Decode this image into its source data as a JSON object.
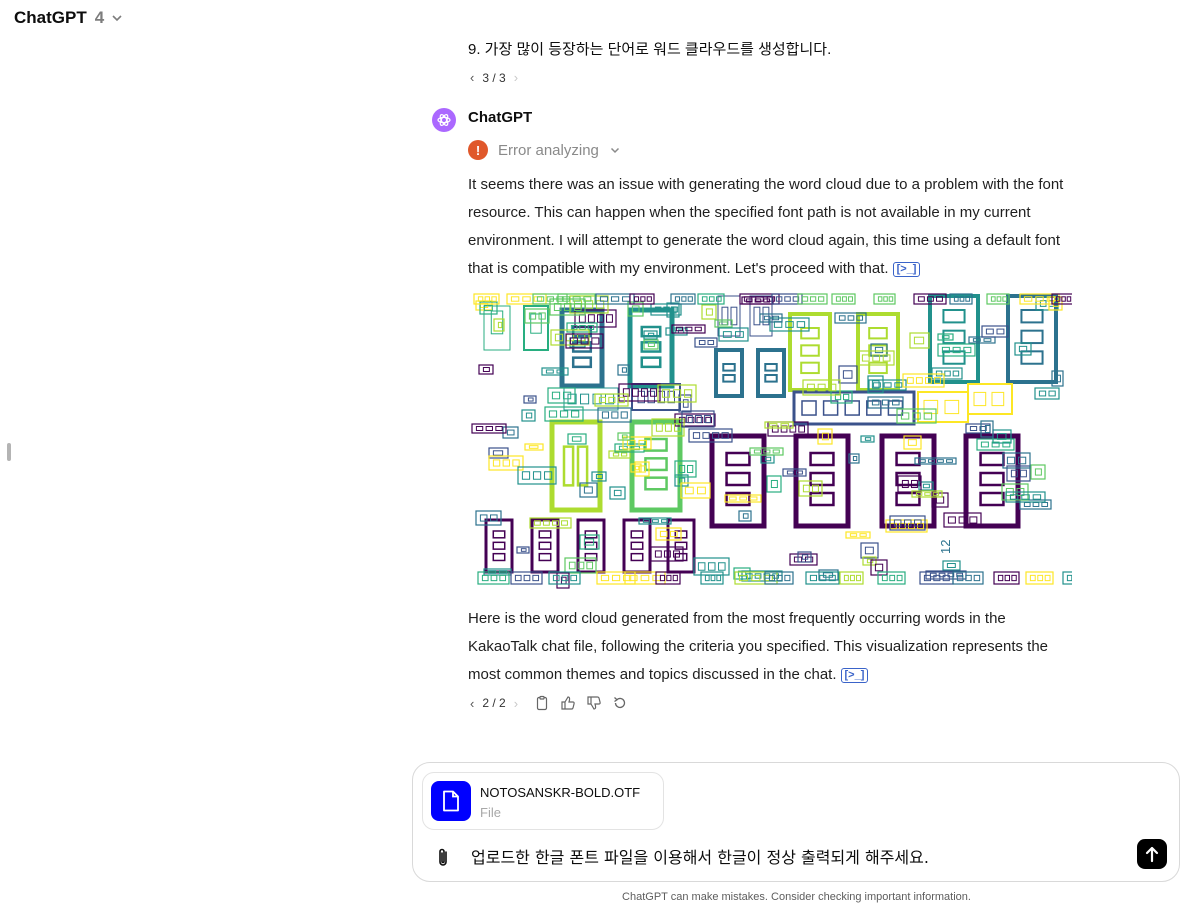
{
  "header": {
    "title": "ChatGPT",
    "version": "4"
  },
  "previous_message": {
    "last_line": "9. 가장 많이 등장하는 단어로 워드 클라우드를 생성합니다.",
    "pager": "3 / 3"
  },
  "assistant": {
    "name": "ChatGPT",
    "status": "Error analyzing",
    "paragraph1": "It seems there was an issue with generating the word cloud due to a problem with the font resource. This can happen when the specified font path is not available in my current environment. I will attempt to generate the word cloud again, this time using a default font that is compatible with my environment. Let's proceed with that.",
    "paragraph2": "Here is the word cloud generated from the most frequently occurring words in the KakaoTalk chat file, following the criteria you specified. This visualization represents the most common themes and topics discussed in the chat.",
    "cite_label": "[>_]",
    "pager": "2 / 2",
    "cloud_text": "12"
  },
  "composer": {
    "file_name": "NOTOSANSKR-BOLD.OTF",
    "file_type": "File",
    "input_value": "업로드한 한글 폰트 파일을 이용해서 한글이 정상 출력되게 해주세요."
  },
  "disclaimer": "ChatGPT can make mistakes. Consider checking important information.",
  "colors": {
    "cloud_palette": [
      "#440154",
      "#3b528b",
      "#2c728e",
      "#21918c",
      "#28ae80",
      "#5ec962",
      "#addc30",
      "#fde725"
    ],
    "error": "#e0582b",
    "avatar": "#ab68ff",
    "file_icon": "#0000ff"
  }
}
